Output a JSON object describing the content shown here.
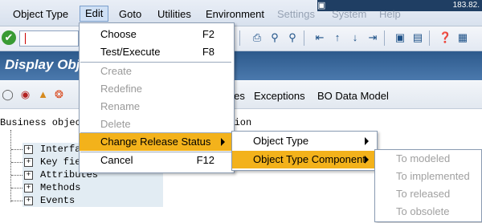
{
  "menubar": {
    "items": [
      "Object Type",
      "Edit",
      "Goto",
      "Utilities",
      "Environment",
      "Settings",
      "System",
      "Help"
    ],
    "version": "183.82."
  },
  "header": {
    "title": "Display Object Type"
  },
  "app_toolbar": {
    "tabs": [
      "Attributes",
      "Exceptions",
      "BO Data Model"
    ]
  },
  "tree": {
    "root_prefix": "Business object",
    "root_suffix": "cation",
    "nodes": [
      "Interfaces",
      "Key fields",
      "Attributes",
      "Methods",
      "Events"
    ]
  },
  "edit_menu": {
    "items": [
      {
        "label": "Choose",
        "shortcut": "F2",
        "state": "normal"
      },
      {
        "label": "Test/Execute",
        "shortcut": "F8",
        "state": "normal"
      },
      {
        "label": "Create",
        "shortcut": "",
        "state": "disabled"
      },
      {
        "label": "Redefine",
        "shortcut": "",
        "state": "disabled"
      },
      {
        "label": "Rename",
        "shortcut": "",
        "state": "disabled"
      },
      {
        "label": "Delete",
        "shortcut": "",
        "state": "disabled"
      },
      {
        "label": "Change Release Status",
        "shortcut": "",
        "state": "selected"
      },
      {
        "label": "Cancel",
        "shortcut": "F12",
        "state": "normal"
      }
    ]
  },
  "release_submenu": {
    "items": [
      {
        "label": "Object Type",
        "state": "normal"
      },
      {
        "label": "Object Type Component",
        "state": "selected"
      }
    ]
  },
  "component_submenu": {
    "items": [
      "To modeled",
      "To implemented",
      "To released",
      "To obsolete"
    ]
  },
  "colors": {
    "highlight": "#f3b21b",
    "header": "#3a6a9e",
    "disabled": "#9a9a9a"
  }
}
